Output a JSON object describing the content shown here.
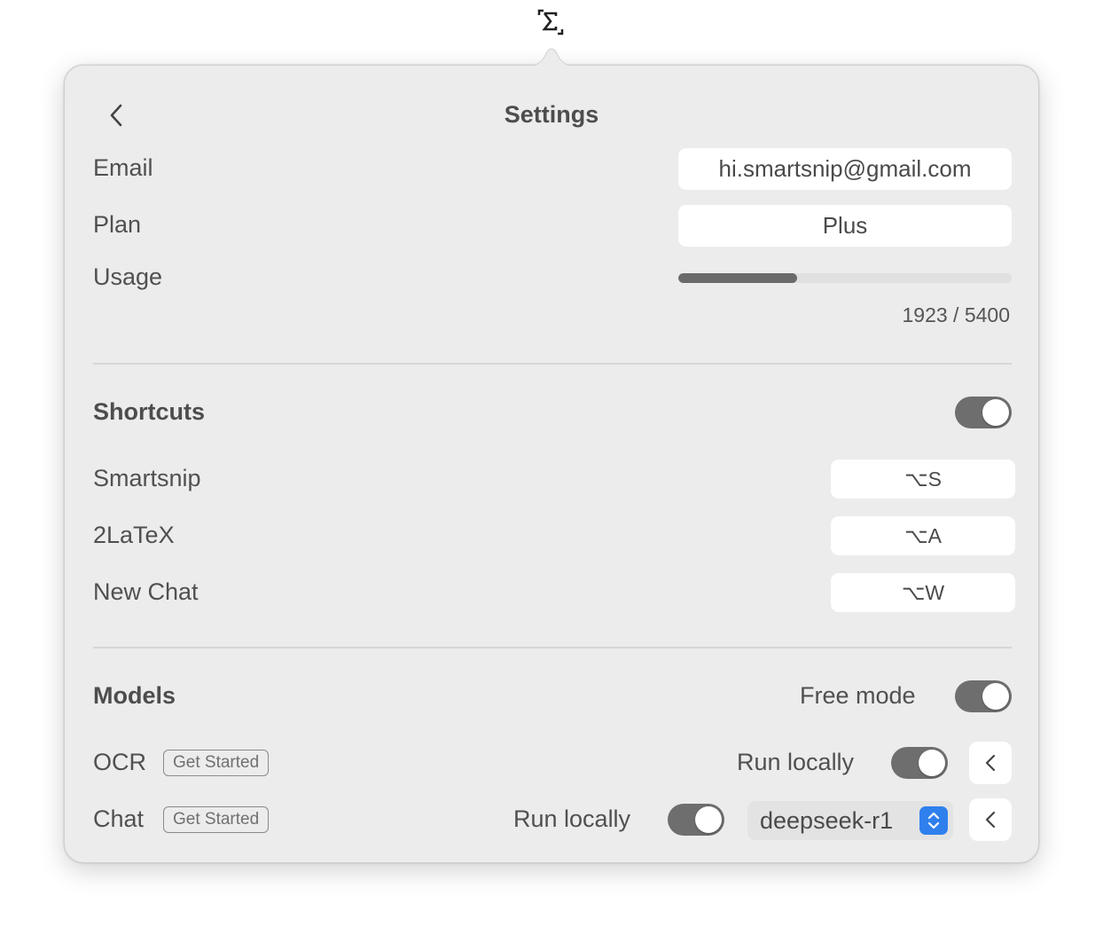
{
  "menubar": {
    "icon": "sigma-bracket-icon"
  },
  "header": {
    "title": "Settings",
    "back_icon": "chevron-left-icon"
  },
  "account": {
    "email_label": "Email",
    "email_value": "hi.smartsnip@gmail.com",
    "plan_label": "Plan",
    "plan_value": "Plus",
    "usage_label": "Usage",
    "usage_used": 1923,
    "usage_total": 5400,
    "usage_text": "1923 / 5400"
  },
  "shortcuts": {
    "title": "Shortcuts",
    "enabled": true,
    "items": [
      {
        "label": "Smartsnip",
        "keys": "⌥S"
      },
      {
        "label": "2LaTeX",
        "keys": "⌥A"
      },
      {
        "label": "New Chat",
        "keys": "⌥W"
      }
    ]
  },
  "models": {
    "title": "Models",
    "free_mode_label": "Free mode",
    "free_mode_enabled": true,
    "ocr": {
      "label": "OCR",
      "badge": "Get Started",
      "run_locally_label": "Run locally",
      "run_locally_enabled": true
    },
    "chat": {
      "label": "Chat",
      "badge": "Get Started",
      "run_locally_label": "Run locally",
      "run_locally_enabled": true,
      "model_selected": "deepseek-r1"
    }
  },
  "colors": {
    "panel_bg": "#ececec",
    "toggle_on": "#6e6e6e",
    "stepper_accent": "#2f80ed"
  }
}
